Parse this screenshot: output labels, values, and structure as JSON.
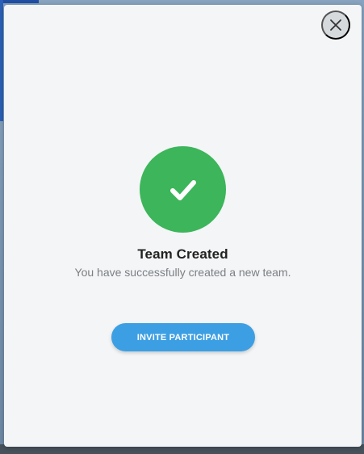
{
  "modal": {
    "title": "Team Created",
    "subtitle": "You have successfully created a new team.",
    "invite_button_label": "INVITE PARTICIPANT",
    "close_icon": "close-icon",
    "success_icon": "check-icon"
  },
  "colors": {
    "success": "#3cb55b",
    "primary_button": "#3d9fe3",
    "modal_background": "#f3f5f6"
  }
}
